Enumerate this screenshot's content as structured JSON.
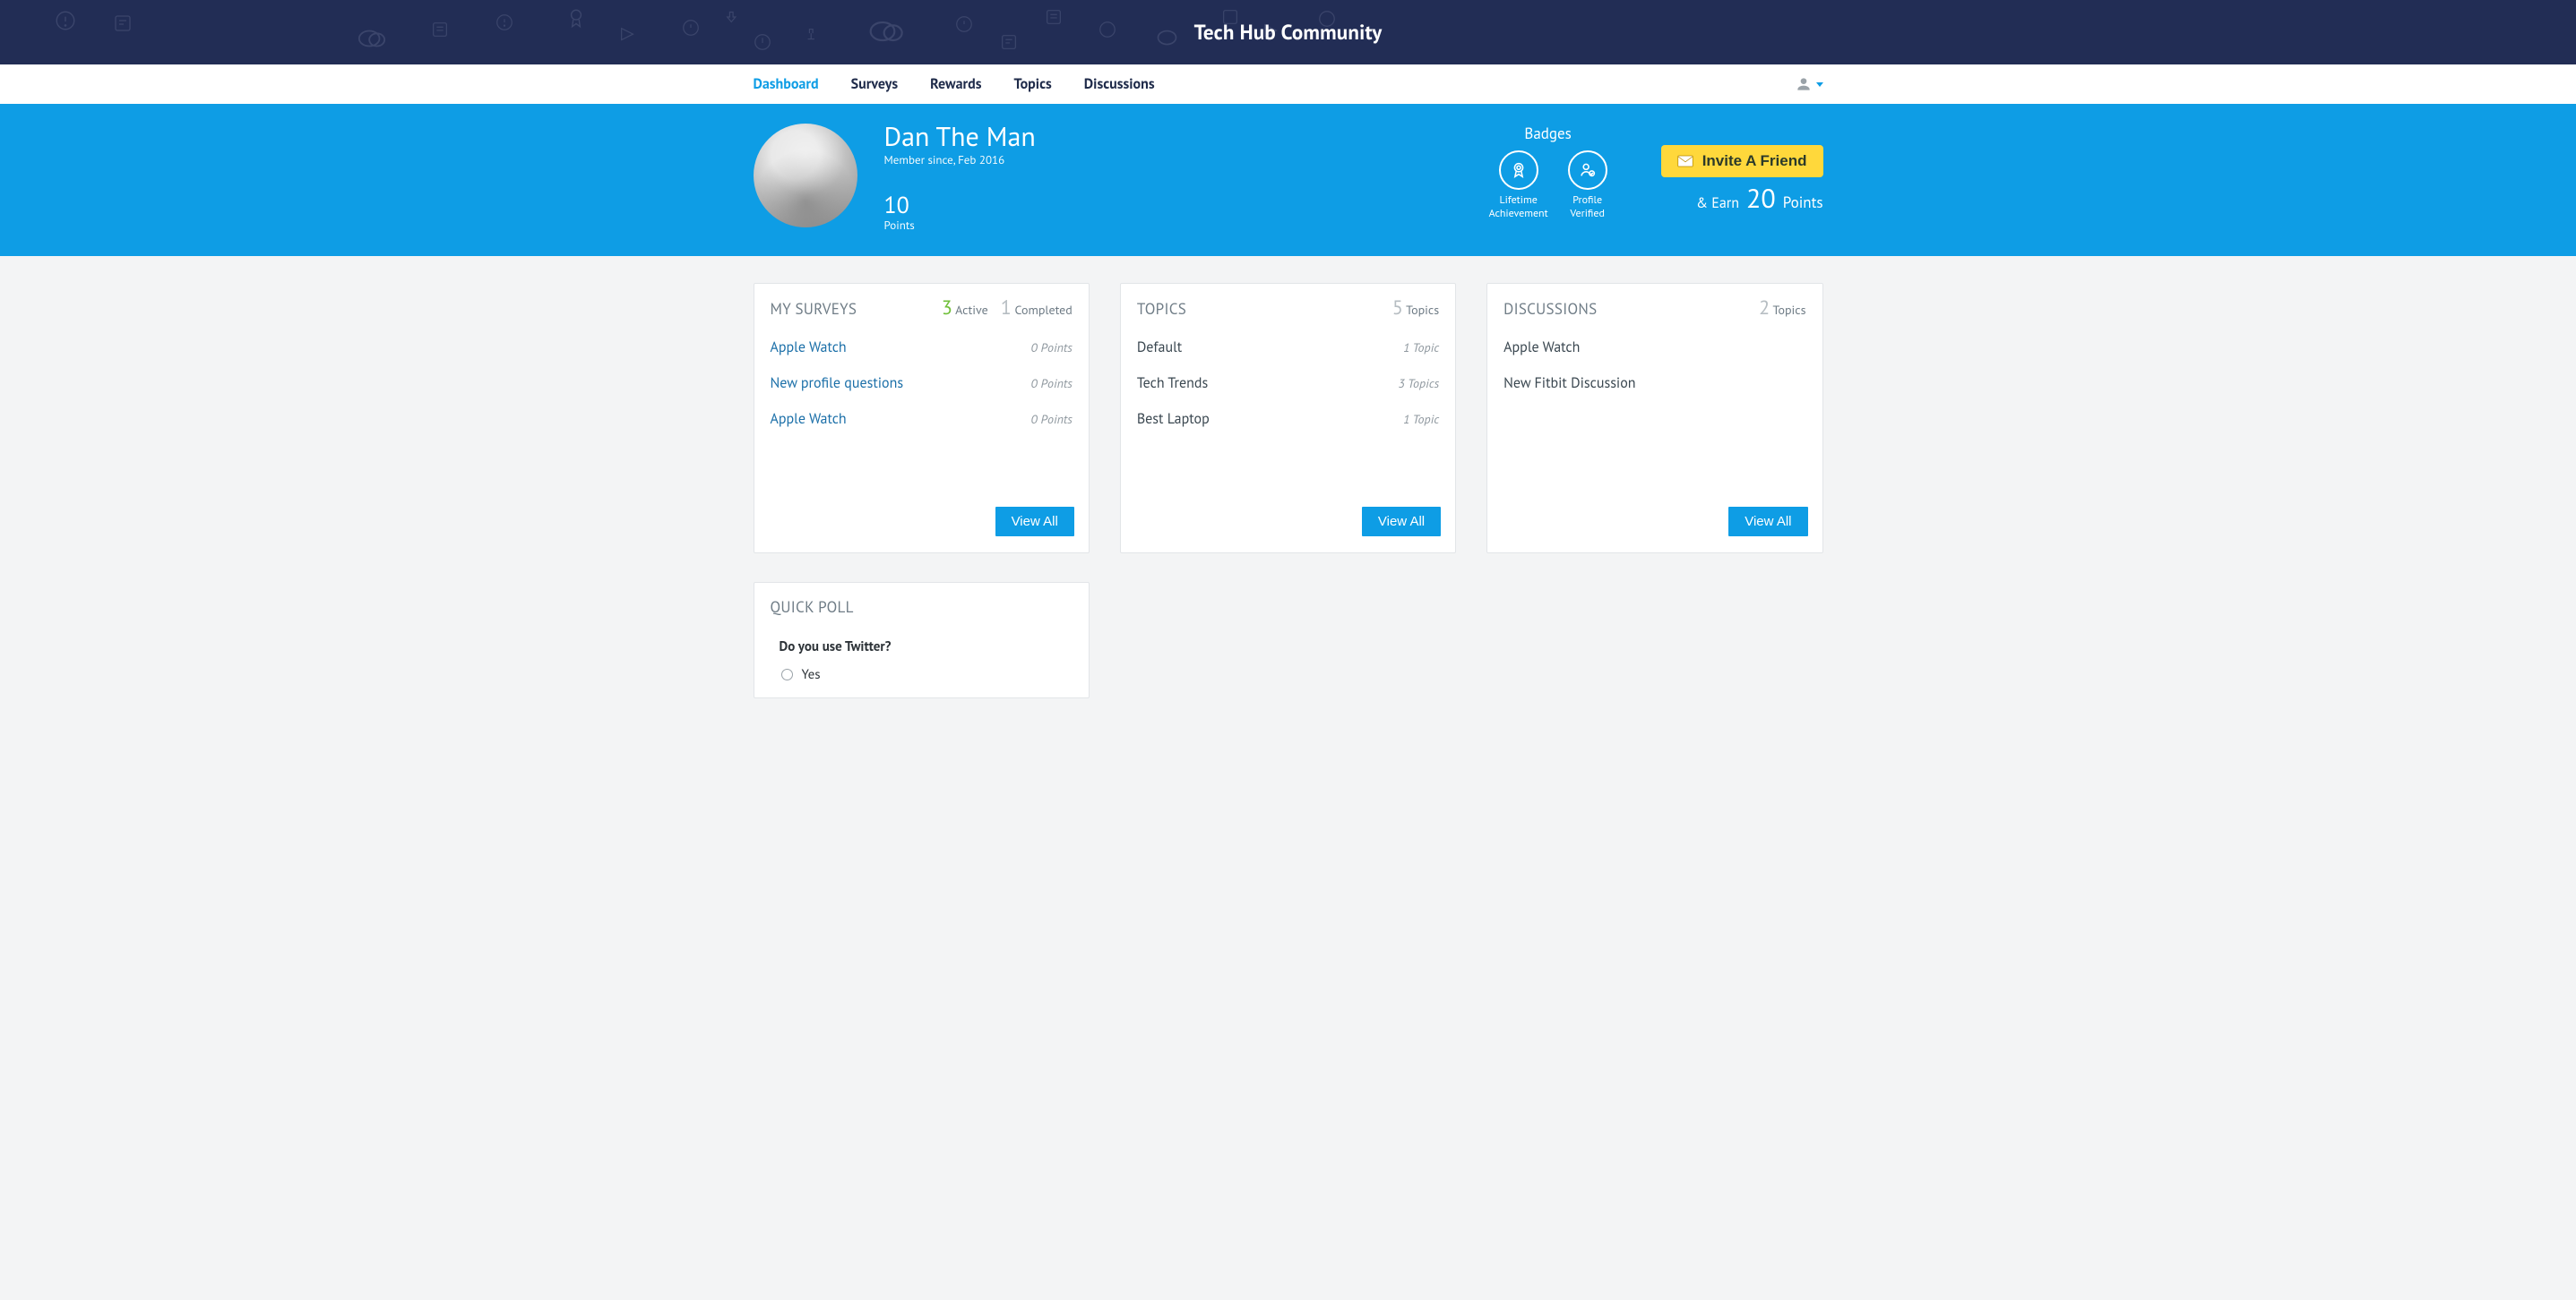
{
  "brand": "Tech Hub Community",
  "nav": {
    "items": [
      {
        "label": "Dashboard",
        "active": true
      },
      {
        "label": "Surveys",
        "active": false
      },
      {
        "label": "Rewards",
        "active": false
      },
      {
        "label": "Topics",
        "active": false
      },
      {
        "label": "Discussions",
        "active": false
      }
    ]
  },
  "profile": {
    "display_name": "Dan The Man",
    "member_since": "Member since, Feb 2016",
    "points_value": "10",
    "points_label": "Points"
  },
  "badges": {
    "heading": "Badges",
    "items": [
      {
        "name": "Lifetime Achievement",
        "line1": "Lifetime",
        "line2": "Achievement",
        "icon": "ribbon"
      },
      {
        "name": "Profile Verified",
        "line1": "Profile",
        "line2": "Verified",
        "icon": "user-check"
      }
    ]
  },
  "invite": {
    "button_label": "Invite A Friend",
    "earn_prefix": "& Earn",
    "earn_points": "20",
    "earn_suffix": "Points"
  },
  "cards": {
    "surveys": {
      "title": "MY SURVEYS",
      "active_count": "3",
      "active_label": "Active",
      "completed_count": "1",
      "completed_label": "Completed",
      "items": [
        {
          "label": "Apple Watch",
          "meta": "0 Points"
        },
        {
          "label": "New profile questions",
          "meta": "0 Points"
        },
        {
          "label": "Apple Watch",
          "meta": "0 Points"
        }
      ],
      "view_all": "View All"
    },
    "topics": {
      "title": "TOPICS",
      "count": "5",
      "count_label": "Topics",
      "items": [
        {
          "label": "Default",
          "meta": "1 Topic"
        },
        {
          "label": "Tech Trends",
          "meta": "3 Topics"
        },
        {
          "label": "Best Laptop",
          "meta": "1 Topic"
        }
      ],
      "view_all": "View All"
    },
    "discussions": {
      "title": "DISCUSSIONS",
      "count": "2",
      "count_label": "Topics",
      "items": [
        {
          "label": "Apple Watch"
        },
        {
          "label": "New Fitbit Discussion"
        }
      ],
      "view_all": "View All"
    }
  },
  "poll": {
    "title": "QUICK POLL",
    "question": "Do you use Twitter?",
    "options": [
      {
        "label": "Yes"
      }
    ]
  }
}
